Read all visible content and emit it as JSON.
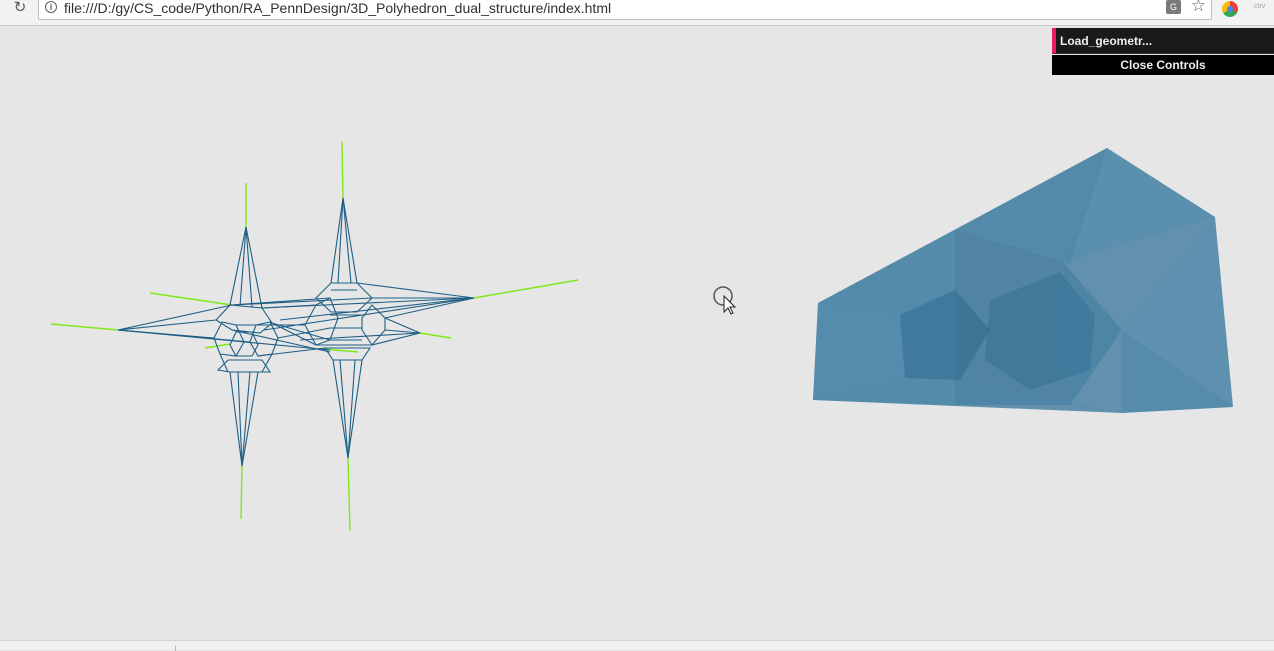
{
  "browser": {
    "url": "file:///D:/gy/CS_code/Python/RA_PennDesign/3D_Polyhedron_dual_structure/index.html",
    "reload_icon": "reload-icon",
    "info_icon": "info-icon",
    "translate_icon": "translate-icon",
    "bookmark_icon": "star-icon"
  },
  "gui": {
    "controller_label": "Load_geometr...",
    "close_label": "Close Controls",
    "accent_color": "#e61d5f"
  },
  "scene": {
    "background": "#e6e6e6",
    "wireframe_color": "#1f5f85",
    "force_line_color": "#7fe81a",
    "polyhedron_color": "#2f7098"
  }
}
